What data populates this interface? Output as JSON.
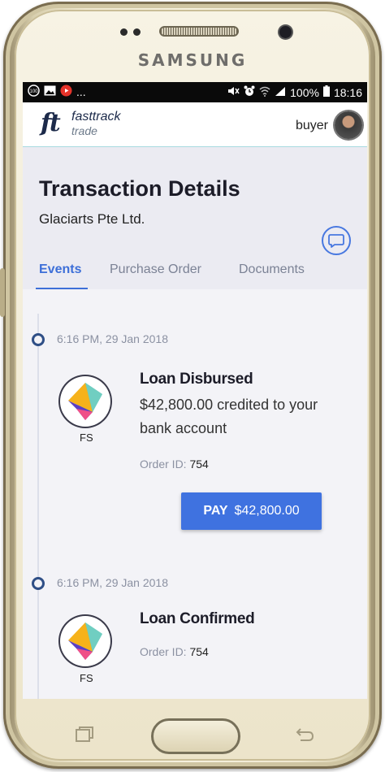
{
  "device": {
    "brand": "SAMSUNG"
  },
  "statusbar": {
    "battery": "100%",
    "time": "18:16",
    "dots": "..."
  },
  "app": {
    "logo_mark": "ft",
    "logo_name": "fasttrack",
    "logo_sub": "trade",
    "user_label": "buyer"
  },
  "page": {
    "title": "Transaction Details",
    "subtitle": "Glaciarts Pte Ltd."
  },
  "tabs": [
    {
      "label": "Events",
      "active": true
    },
    {
      "label": "Purchase Order",
      "active": false
    },
    {
      "label": "Documents",
      "active": false
    }
  ],
  "events": [
    {
      "time": "6:16 PM, 29 Jan 2018",
      "avatar_label": "FS",
      "title": "Loan Disbursed",
      "description": "$42,800.00 credited to your bank account",
      "order_label": "Order ID:",
      "order_id": "754",
      "pay_label": "PAY",
      "pay_amount": "$42,800.00"
    },
    {
      "time": "6:16 PM, 29 Jan 2018",
      "avatar_label": "FS",
      "title": "Loan Confirmed",
      "order_label": "Order ID:",
      "order_id": "754"
    }
  ],
  "colors": {
    "accent": "#3f72e0",
    "logo_dark": "#1c2a4a",
    "logo_teal": "#2ba3c3"
  }
}
